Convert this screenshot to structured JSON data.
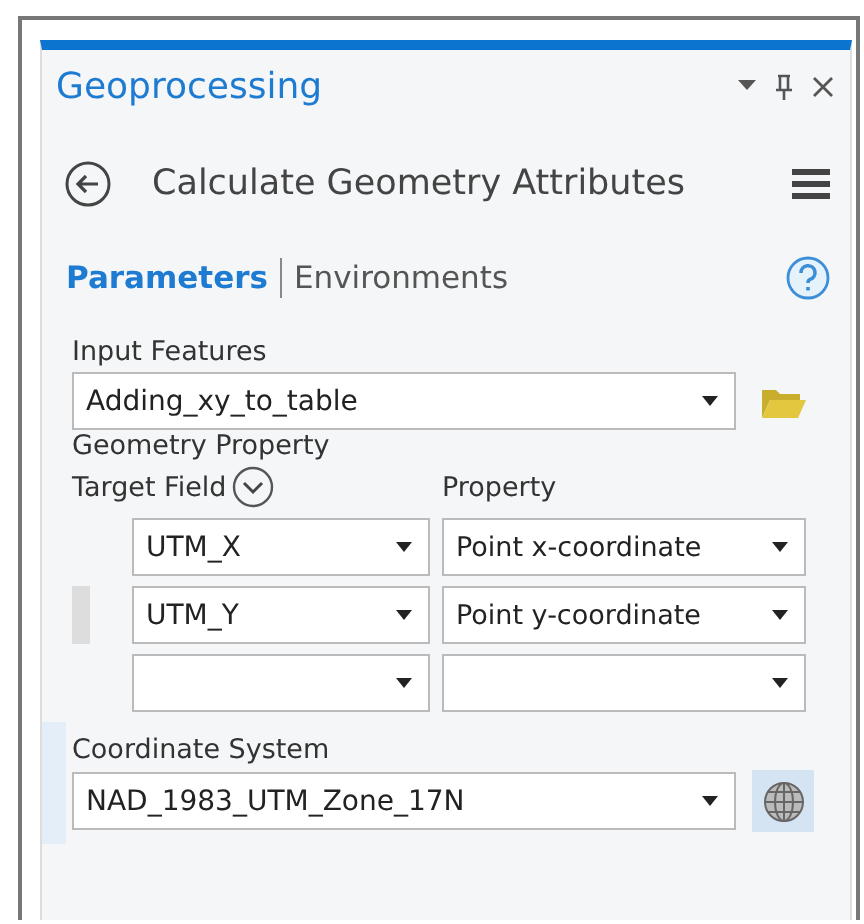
{
  "panel": {
    "title": "Geoprocessing"
  },
  "tool": {
    "title": "Calculate Geometry Attributes"
  },
  "tabs": [
    {
      "label": "Parameters",
      "selected": true
    },
    {
      "label": "Environments",
      "selected": false
    }
  ],
  "input_features": {
    "label": "Input Features",
    "value": "Adding_xy_to_table"
  },
  "geometry_property": {
    "label": "Geometry Property",
    "columns": [
      "Target Field",
      "Property"
    ],
    "rows": [
      {
        "target_field": "UTM_X",
        "property": "Point x-coordinate",
        "selected": false
      },
      {
        "target_field": "UTM_Y",
        "property": "Point y-coordinate",
        "selected": true
      },
      {
        "selected": false
      }
    ]
  },
  "coordinate_system": {
    "label": "Coordinate System",
    "value": "NAD_1983_UTM_Zone_17N",
    "selected": true
  }
}
